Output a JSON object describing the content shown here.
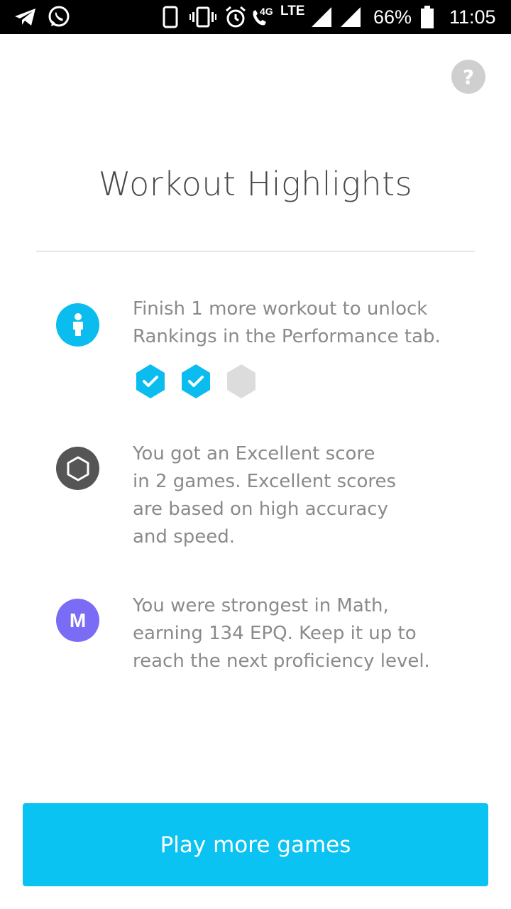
{
  "status_bar": {
    "network_type": "4G",
    "lte_label": "LTE",
    "battery_percent": "66%",
    "time": "11:05",
    "icons": [
      "telegram-icon",
      "whatsapp-icon",
      "phone-icon",
      "vibrate-icon",
      "alarm-icon",
      "call-icon",
      "signal-icon",
      "signal-icon",
      "battery-icon"
    ]
  },
  "help": {
    "label": "?"
  },
  "header": {
    "title": "Workout Highlights"
  },
  "highlights": [
    {
      "icon": "person-icon",
      "icon_color": "#0bbcef",
      "lines": [
        "Finish 1 more workout to unlock",
        "Rankings in the Performance tab."
      ],
      "progress": {
        "completed": 2,
        "total": 3
      }
    },
    {
      "icon": "hexagon-outline-icon",
      "icon_color": "#555555",
      "lines": [
        "You got an Excellent score",
        "in 2 games. Excellent scores",
        "are based on high accuracy",
        "and speed."
      ]
    },
    {
      "icon_letter": "M",
      "icon_color": "#7b6cf6",
      "lines": [
        "You were strongest in Math,",
        "earning 134 EPQ. Keep it up to",
        "reach the next proficiency level."
      ]
    }
  ],
  "cta": {
    "label": "Play more games",
    "color": "#0bc3f2"
  }
}
